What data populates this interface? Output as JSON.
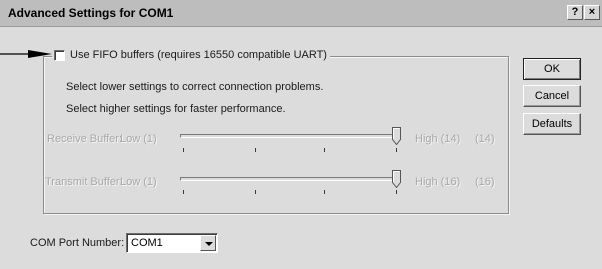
{
  "window": {
    "title": "Advanced Settings for COM1",
    "help_label": "?",
    "close_label": "×"
  },
  "fifo": {
    "checkbox_label": "Use FIFO buffers (requires 16550 compatible UART)",
    "checked": false,
    "hint_lower": "Select lower settings to correct connection problems.",
    "hint_higher": "Select higher settings for faster performance."
  },
  "receive_buffer": {
    "label": "Receive Buffer:",
    "low_label": "Low (1)",
    "high_label": "High (14)",
    "value_label": "(14)",
    "value": 14,
    "min": 1,
    "max": 14
  },
  "transmit_buffer": {
    "label": "Transmit Buffer:",
    "low_label": "Low (1)",
    "high_label": "High (16)",
    "value_label": "(16)",
    "value": 16,
    "min": 1,
    "max": 16
  },
  "com_port": {
    "label": "COM Port Number:",
    "selected": "COM1"
  },
  "buttons": {
    "ok": "OK",
    "cancel": "Cancel",
    "defaults": "Defaults"
  },
  "colors": {
    "dialog_bg": "#dcdcdc",
    "titlebar_bg": "#bdbdbd",
    "disabled_text": "#a9a9a9"
  }
}
